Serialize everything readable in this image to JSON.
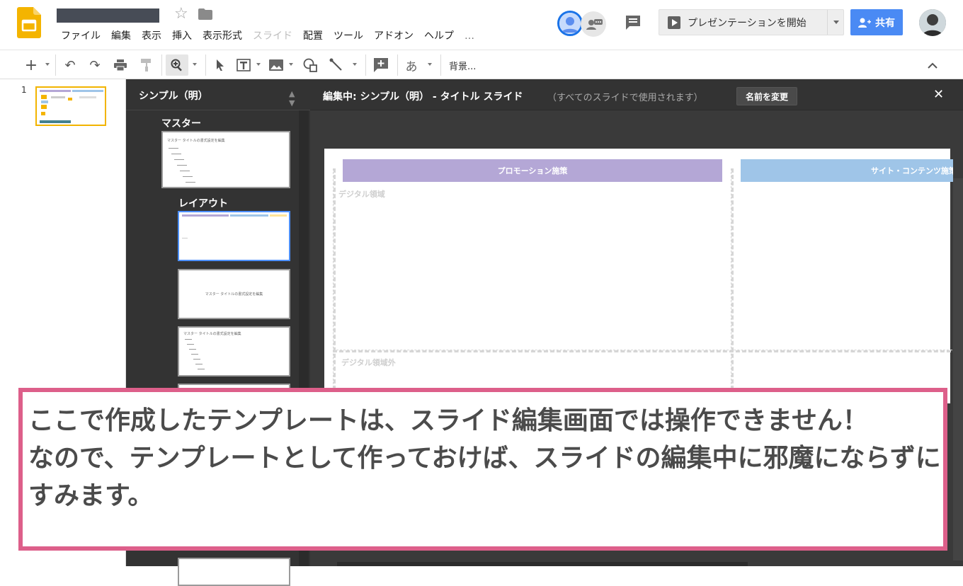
{
  "app": {
    "doc_title": "",
    "menu": [
      {
        "label": "ファイル",
        "disabled": false
      },
      {
        "label": "編集",
        "disabled": false
      },
      {
        "label": "表示",
        "disabled": false
      },
      {
        "label": "挿入",
        "disabled": false
      },
      {
        "label": "表示形式",
        "disabled": false
      },
      {
        "label": "スライド",
        "disabled": true
      },
      {
        "label": "配置",
        "disabled": false
      },
      {
        "label": "ツール",
        "disabled": false
      },
      {
        "label": "アドオン",
        "disabled": false
      },
      {
        "label": "ヘルプ",
        "disabled": false
      },
      {
        "label": "…",
        "disabled": false
      }
    ],
    "present_label": "プレゼンテーションを開始",
    "share_label": "共有"
  },
  "toolbar": {
    "background_label": "背景...",
    "text_style_glyph": "あ"
  },
  "filmstrip": {
    "slide_number": "1"
  },
  "layout_panel": {
    "theme_name": "シンプル（明）",
    "master_label": "マスター",
    "layout_label": "レイアウト",
    "master_thumb_title": "マスター タイトルの書式設定を編集",
    "layout_thumb2_text": "マスター タイトルの書式設定を編集",
    "layout_thumb3_title": "マスター タイトルの書式設定を編集"
  },
  "editor": {
    "editing_label": "編集中: シンプル（明） - タイトル スライド",
    "editing_note": "（すべてのスライドで使用されます）",
    "rename_label": "名前を変更",
    "columns": [
      {
        "label": "プロモーション施策",
        "color": "#b4a7d6"
      },
      {
        "label": "サイト・コンテンツ施策",
        "color": "#9fc5e8"
      }
    ],
    "regions": [
      "デジタル領域",
      "デジタル領域外"
    ]
  },
  "annotation": {
    "text": "ここで作成したテンプレートは、スライド編集画面では操作できません！\nなので、テンプレートとして作っておけば、スライドの編集中に邪魔にならずにすみます。",
    "border_color": "#dd5f8a"
  }
}
